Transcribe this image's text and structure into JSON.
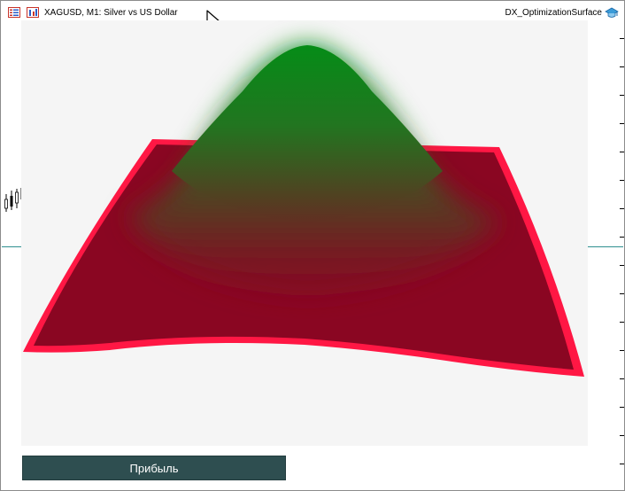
{
  "header": {
    "symbol_title": "XAGUSD, M1:  Silver vs US Dollar",
    "indicator_name": "DX_OptimizationSurface",
    "icons": [
      "list-icon",
      "chart-icon",
      "graduation-cap-icon"
    ]
  },
  "button": {
    "label": "Прибыль"
  },
  "colors": {
    "surface_peak": "#058c17",
    "surface_base": "#8a0622",
    "surface_edge": "#ff1744",
    "panel_bg": "#f5f5f5",
    "button_bg": "#2e4e50",
    "price_line": "#2f8f8f"
  }
}
